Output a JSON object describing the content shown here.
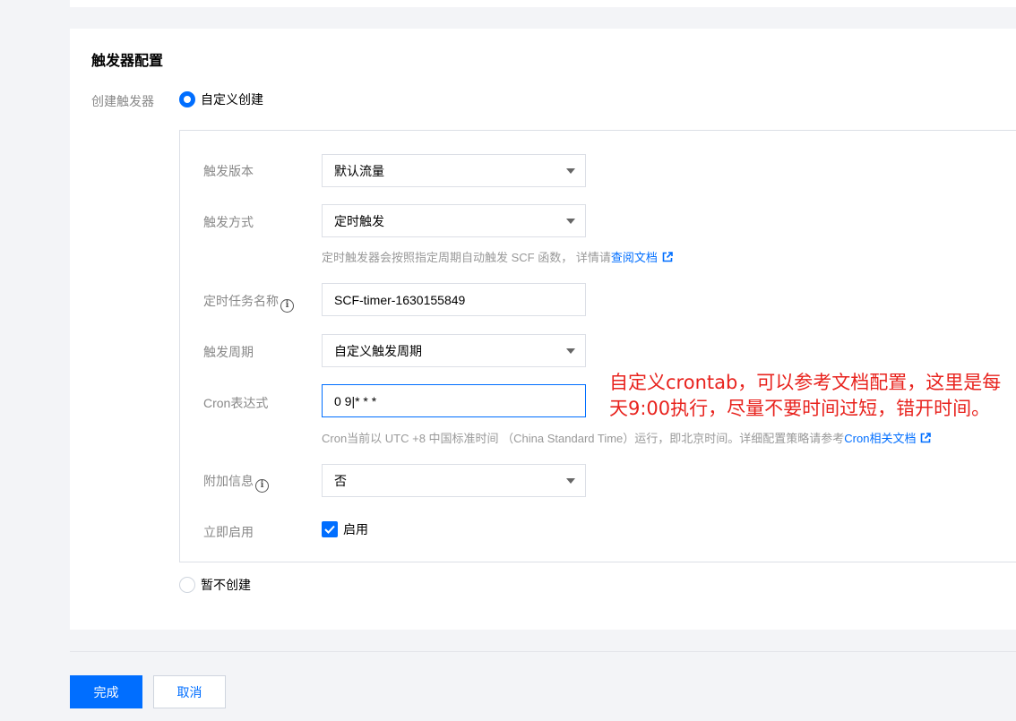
{
  "section": {
    "title": "触发器配置",
    "create_label": "创建触发器",
    "custom_create": "自定义创建",
    "no_create": "暂不创建"
  },
  "form": {
    "version": {
      "label": "触发版本",
      "value": "默认流量"
    },
    "method": {
      "label": "触发方式",
      "value": "定时触发",
      "hint_prefix": "定时触发器会按照指定周期自动触发 SCF 函数， 详情请",
      "hint_link": "查阅文档"
    },
    "task_name": {
      "label": "定时任务名称",
      "value": "SCF-timer-1630155849"
    },
    "period": {
      "label": "触发周期",
      "value": "自定义触发周期"
    },
    "cron": {
      "label": "Cron表达式",
      "value": "0 9|* * *",
      "hint_prefix": "Cron当前以 UTC +8 中国标准时间 （China Standard Time）运行，即北京时间。详细配置策略请参考",
      "hint_link": "Cron相关文档"
    },
    "extra": {
      "label": "附加信息",
      "value": "否"
    },
    "enable": {
      "label": "立即启用",
      "checkbox_label": "启用",
      "checked": true
    }
  },
  "annotation": {
    "line1": "自定义crontab，可以参考文档配置，这里是每",
    "line2": "天9:00执行，尽量不要时间过短，错开时间。"
  },
  "footer": {
    "confirm_label": "完成",
    "cancel_label": "取消"
  },
  "colors": {
    "accent": "#006eff",
    "annotation": "#e8231e"
  },
  "icons": {
    "info": "info-icon",
    "external": "external-link-icon",
    "check": "check-icon",
    "dropdown": "chevron-down-icon"
  }
}
